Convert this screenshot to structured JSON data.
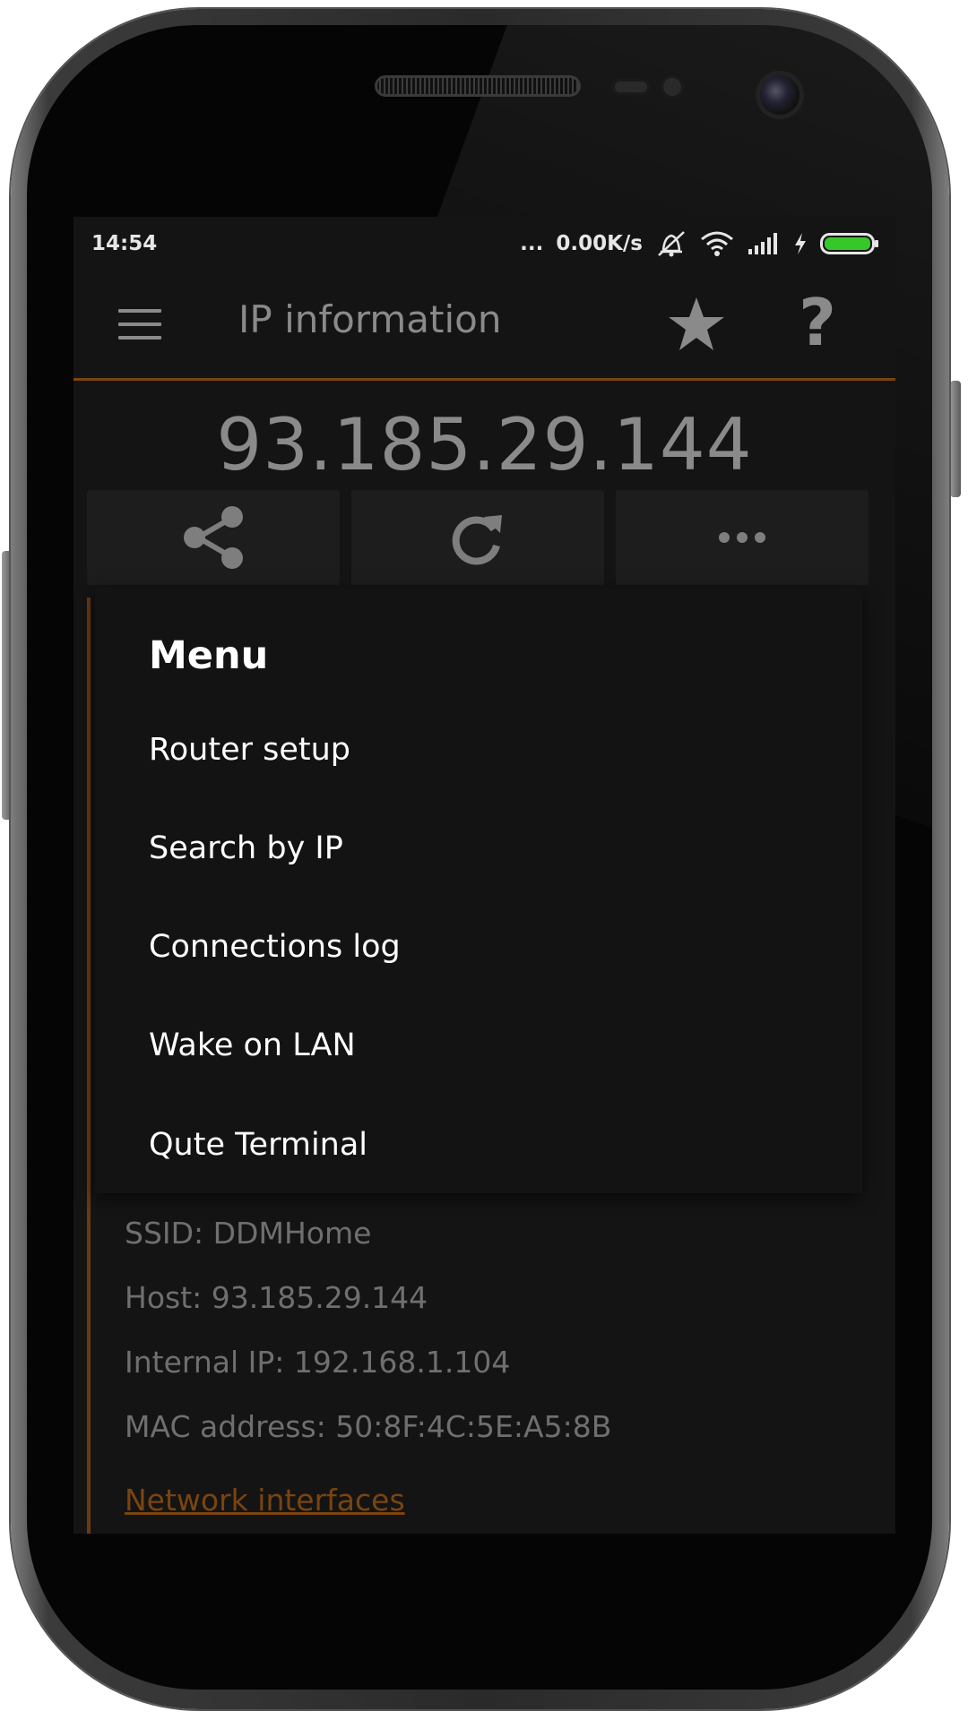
{
  "status_bar": {
    "time": "14:54",
    "dots": "...",
    "speed": "0.00K/s"
  },
  "app_bar": {
    "title": "IP information",
    "icons": [
      "menu-icon",
      "star-icon",
      "help-icon"
    ],
    "help_glyph": "?"
  },
  "main": {
    "ip": "93.185.29.144",
    "actions": [
      "share-icon",
      "refresh-icon",
      "more-icon"
    ]
  },
  "info": {
    "ssid": "SSID: DDMHome",
    "host": "Host: 93.185.29.144",
    "internal_ip": "Internal IP: 192.168.1.104",
    "mac": "MAC address: 50:8F:4C:5E:A5:8B",
    "link": "Network interfaces"
  },
  "menu": {
    "title": "Menu",
    "items": [
      {
        "label": "Router setup"
      },
      {
        "label": "Search by IP"
      },
      {
        "label": "Connections log"
      },
      {
        "label": "Wake on LAN"
      },
      {
        "label": "Qute Terminal"
      }
    ]
  },
  "colors": {
    "accent": "#7a4410",
    "battery": "#36c82a"
  }
}
